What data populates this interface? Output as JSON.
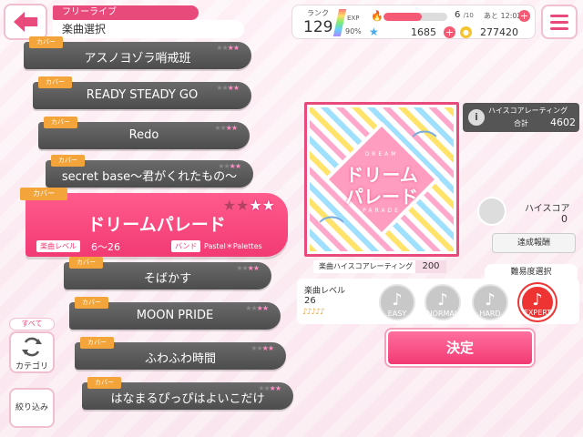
{
  "header": {
    "tag": "フリーライブ",
    "title": "楽曲選択"
  },
  "songs": [
    {
      "cover": "カバー",
      "title": "アスノヨゾラ哨戒班",
      "stars_gray": "★★",
      "stars_pink": "★★"
    },
    {
      "cover": "カバー",
      "title": "READY STEADY GO",
      "stars_gray": "★★",
      "stars_pink": "★★"
    },
    {
      "cover": "カバー",
      "title": "Redo",
      "stars_gray": "★★",
      "stars_pink": "★★"
    },
    {
      "cover": "カバー",
      "title": "secret base～君がくれたもの～",
      "stars_gray": "★★",
      "stars_pink": "★★"
    },
    {
      "cover": "カバー",
      "title": "そばかす",
      "stars_gray": "★★",
      "stars_pink": "★★"
    },
    {
      "cover": "カバー",
      "title": "MOON PRIDE",
      "stars_gray": "★★",
      "stars_pink": "★★"
    },
    {
      "cover": "カバー",
      "title": "ふわふわ時間",
      "stars_gray": "★★",
      "stars_pink": "★★"
    },
    {
      "cover": "カバー",
      "title": "はなまるぴっぴはよいこだけ",
      "stars_gray": "★★",
      "stars_pink": "★★"
    }
  ],
  "selected": {
    "cover": "カバー",
    "title": "ドリームパレード",
    "level_label": "楽曲レベル",
    "level_range": "6～26",
    "band_label": "バンド",
    "band": "Pastel＊Palettes",
    "stars_gray": "★★",
    "stars_white": "★★"
  },
  "left_controls": {
    "all_label": "すべて",
    "category_label": "カテゴリ",
    "filter_label": "絞り込み"
  },
  "status": {
    "rank_label": "ランク",
    "rank": "129",
    "exp_label": "EXP",
    "exp_percent": "90%",
    "stamina_fraction": 0.6,
    "stamina": "6",
    "stamina_max": "/10",
    "stamina_time": "あと 12:02",
    "gems": "1685",
    "coins": "277420"
  },
  "jacket": {
    "dream": "DREAM",
    "title_line1": "ドリーム",
    "title_line2": "パレード",
    "parade": "PARADE"
  },
  "rating": {
    "label": "ハイスコアレーティング",
    "sub_label": "合計",
    "value": "4602"
  },
  "highscore": {
    "label": "ハイスコア",
    "value": "0",
    "result_button": "達成報酬"
  },
  "song_highscore_rating": {
    "label": "楽曲ハイスコアレーティング",
    "value": "200"
  },
  "difficulty": {
    "tab_label": "難易度選択",
    "level_label": "楽曲レベル",
    "level_value": "26",
    "notes": "♪♪♪♪♪",
    "options": [
      {
        "name": "EASY",
        "selected": false
      },
      {
        "name": "NORMAL",
        "selected": false
      },
      {
        "name": "HARD",
        "selected": false
      },
      {
        "name": "EXPERT",
        "selected": true
      }
    ]
  },
  "decide_button": "決定",
  "colors": {
    "accent": "#f23a74",
    "cover_tag": "#f3a53b",
    "song_bar": "#555555",
    "expert": "#e33333"
  }
}
